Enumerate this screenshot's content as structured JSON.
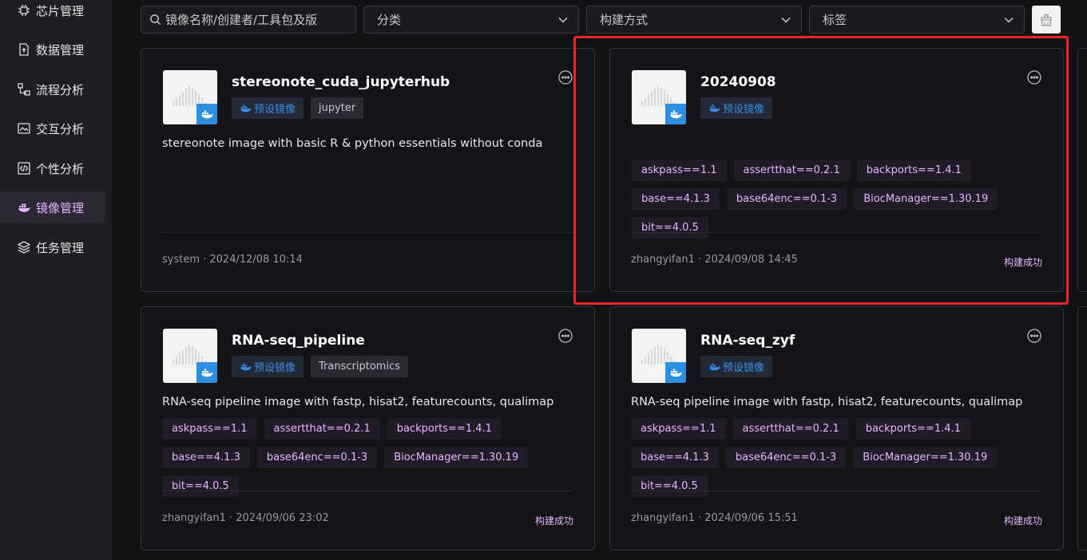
{
  "sidebar": {
    "items": [
      {
        "label": "芯片管理",
        "icon": "chip-icon"
      },
      {
        "label": "数据管理",
        "icon": "file-upload-icon"
      },
      {
        "label": "流程分析",
        "icon": "flow-icon"
      },
      {
        "label": "交互分析",
        "icon": "chart-image-icon"
      },
      {
        "label": "个性分析",
        "icon": "code-icon"
      },
      {
        "label": "镜像管理",
        "icon": "docker-icon",
        "active": true
      },
      {
        "label": "任务管理",
        "icon": "layers-icon"
      }
    ]
  },
  "filters": {
    "search_placeholder": "镜像名称/创建者/工具包及版",
    "category": "分类",
    "build_method": "构建方式",
    "tags": "标签"
  },
  "colors": {
    "accent": "#e4b7ff",
    "preset_blue": "#3a8ee6",
    "highlight": "#e8262a"
  },
  "cards": [
    {
      "title": "stereonote_cuda_jupyterhub",
      "tags": [
        "预设镜像",
        "jupyter"
      ],
      "description": "stereonote image with basic R & python essentials without conda",
      "packages": [],
      "meta": "system · 2024/12/08 10:14",
      "status": ""
    },
    {
      "title": "20240908",
      "tags": [
        "预设镜像"
      ],
      "description": "",
      "packages": [
        "askpass==1.1",
        "assertthat==0.2.1",
        "backports==1.4.1",
        "base==4.1.3",
        "base64enc==0.1-3",
        "BiocManager==1.30.19",
        "bit==4.0.5"
      ],
      "meta": "zhangyifan1 · 2024/09/08 14:45",
      "status": "构建成功"
    },
    {
      "title": "RNA-seq_pipeline",
      "tags": [
        "预设镜像",
        "Transcriptomics"
      ],
      "description": "RNA-seq pipeline image with fastp, hisat2, featurecounts, qualimap",
      "packages": [
        "askpass==1.1",
        "assertthat==0.2.1",
        "backports==1.4.1",
        "base==4.1.3",
        "base64enc==0.1-3",
        "BiocManager==1.30.19",
        "bit==4.0.5"
      ],
      "meta": "zhangyifan1 · 2024/09/06 23:02",
      "status": "构建成功"
    },
    {
      "title": "RNA-seq_zyf",
      "tags": [
        "预设镜像"
      ],
      "description": "RNA-seq pipeline image with fastp, hisat2, featurecounts, qualimap",
      "packages": [
        "askpass==1.1",
        "assertthat==0.2.1",
        "backports==1.4.1",
        "base==4.1.3",
        "base64enc==0.1-3",
        "BiocManager==1.30.19",
        "bit==4.0.5"
      ],
      "meta": "zhangyifan1 · 2024/09/06 15:51",
      "status": "构建成功"
    }
  ]
}
